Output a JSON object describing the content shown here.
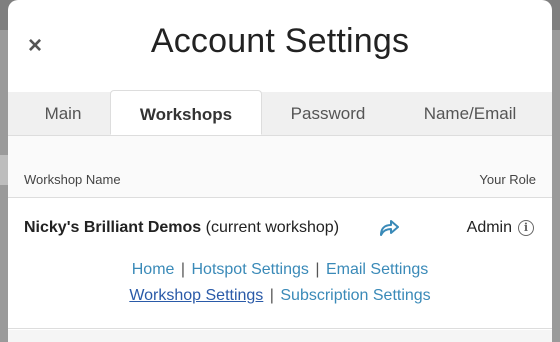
{
  "modal": {
    "title": "Account Settings",
    "close_label": "×"
  },
  "tabs": [
    {
      "label": "Main",
      "active": false
    },
    {
      "label": "Workshops",
      "active": true
    },
    {
      "label": "Password",
      "active": false
    },
    {
      "label": "Name/Email",
      "active": false
    }
  ],
  "table": {
    "col_name": "Workshop Name",
    "col_role": "Your Role",
    "rows": [
      {
        "name": "Nicky's Brilliant Demos",
        "suffix": " (current workshop)",
        "role": "Admin",
        "links_line1": [
          "Home",
          "Hotspot Settings",
          "Email Settings"
        ],
        "links_line2": [
          "Workshop Settings",
          "Subscription Settings"
        ]
      }
    ]
  },
  "separator": "|",
  "colors": {
    "link": "#3a8ab8",
    "active_link": "#2a5aa8",
    "backdrop": "#7f7f7f"
  }
}
